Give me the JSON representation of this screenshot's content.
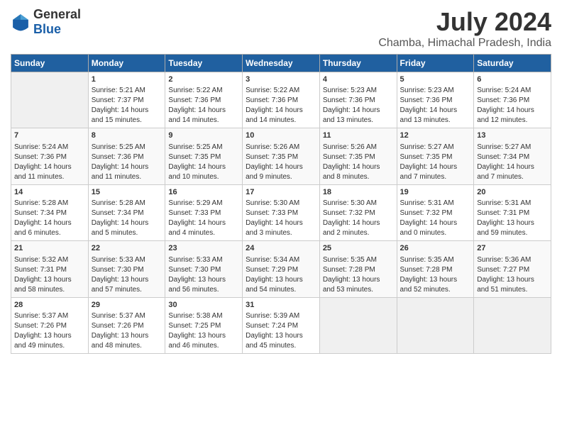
{
  "header": {
    "logo_general": "General",
    "logo_blue": "Blue",
    "title": "July 2024",
    "subtitle": "Chamba, Himachal Pradesh, India"
  },
  "weekdays": [
    "Sunday",
    "Monday",
    "Tuesday",
    "Wednesday",
    "Thursday",
    "Friday",
    "Saturday"
  ],
  "weeks": [
    [
      {
        "day": "",
        "sunrise": "",
        "sunset": "",
        "daylight": ""
      },
      {
        "day": "1",
        "sunrise": "Sunrise: 5:21 AM",
        "sunset": "Sunset: 7:37 PM",
        "daylight": "Daylight: 14 hours and 15 minutes."
      },
      {
        "day": "2",
        "sunrise": "Sunrise: 5:22 AM",
        "sunset": "Sunset: 7:36 PM",
        "daylight": "Daylight: 14 hours and 14 minutes."
      },
      {
        "day": "3",
        "sunrise": "Sunrise: 5:22 AM",
        "sunset": "Sunset: 7:36 PM",
        "daylight": "Daylight: 14 hours and 14 minutes."
      },
      {
        "day": "4",
        "sunrise": "Sunrise: 5:23 AM",
        "sunset": "Sunset: 7:36 PM",
        "daylight": "Daylight: 14 hours and 13 minutes."
      },
      {
        "day": "5",
        "sunrise": "Sunrise: 5:23 AM",
        "sunset": "Sunset: 7:36 PM",
        "daylight": "Daylight: 14 hours and 13 minutes."
      },
      {
        "day": "6",
        "sunrise": "Sunrise: 5:24 AM",
        "sunset": "Sunset: 7:36 PM",
        "daylight": "Daylight: 14 hours and 12 minutes."
      }
    ],
    [
      {
        "day": "7",
        "sunrise": "Sunrise: 5:24 AM",
        "sunset": "Sunset: 7:36 PM",
        "daylight": "Daylight: 14 hours and 11 minutes."
      },
      {
        "day": "8",
        "sunrise": "Sunrise: 5:25 AM",
        "sunset": "Sunset: 7:36 PM",
        "daylight": "Daylight: 14 hours and 11 minutes."
      },
      {
        "day": "9",
        "sunrise": "Sunrise: 5:25 AM",
        "sunset": "Sunset: 7:35 PM",
        "daylight": "Daylight: 14 hours and 10 minutes."
      },
      {
        "day": "10",
        "sunrise": "Sunrise: 5:26 AM",
        "sunset": "Sunset: 7:35 PM",
        "daylight": "Daylight: 14 hours and 9 minutes."
      },
      {
        "day": "11",
        "sunrise": "Sunrise: 5:26 AM",
        "sunset": "Sunset: 7:35 PM",
        "daylight": "Daylight: 14 hours and 8 minutes."
      },
      {
        "day": "12",
        "sunrise": "Sunrise: 5:27 AM",
        "sunset": "Sunset: 7:35 PM",
        "daylight": "Daylight: 14 hours and 7 minutes."
      },
      {
        "day": "13",
        "sunrise": "Sunrise: 5:27 AM",
        "sunset": "Sunset: 7:34 PM",
        "daylight": "Daylight: 14 hours and 7 minutes."
      }
    ],
    [
      {
        "day": "14",
        "sunrise": "Sunrise: 5:28 AM",
        "sunset": "Sunset: 7:34 PM",
        "daylight": "Daylight: 14 hours and 6 minutes."
      },
      {
        "day": "15",
        "sunrise": "Sunrise: 5:28 AM",
        "sunset": "Sunset: 7:34 PM",
        "daylight": "Daylight: 14 hours and 5 minutes."
      },
      {
        "day": "16",
        "sunrise": "Sunrise: 5:29 AM",
        "sunset": "Sunset: 7:33 PM",
        "daylight": "Daylight: 14 hours and 4 minutes."
      },
      {
        "day": "17",
        "sunrise": "Sunrise: 5:30 AM",
        "sunset": "Sunset: 7:33 PM",
        "daylight": "Daylight: 14 hours and 3 minutes."
      },
      {
        "day": "18",
        "sunrise": "Sunrise: 5:30 AM",
        "sunset": "Sunset: 7:32 PM",
        "daylight": "Daylight: 14 hours and 2 minutes."
      },
      {
        "day": "19",
        "sunrise": "Sunrise: 5:31 AM",
        "sunset": "Sunset: 7:32 PM",
        "daylight": "Daylight: 14 hours and 0 minutes."
      },
      {
        "day": "20",
        "sunrise": "Sunrise: 5:31 AM",
        "sunset": "Sunset: 7:31 PM",
        "daylight": "Daylight: 13 hours and 59 minutes."
      }
    ],
    [
      {
        "day": "21",
        "sunrise": "Sunrise: 5:32 AM",
        "sunset": "Sunset: 7:31 PM",
        "daylight": "Daylight: 13 hours and 58 minutes."
      },
      {
        "day": "22",
        "sunrise": "Sunrise: 5:33 AM",
        "sunset": "Sunset: 7:30 PM",
        "daylight": "Daylight: 13 hours and 57 minutes."
      },
      {
        "day": "23",
        "sunrise": "Sunrise: 5:33 AM",
        "sunset": "Sunset: 7:30 PM",
        "daylight": "Daylight: 13 hours and 56 minutes."
      },
      {
        "day": "24",
        "sunrise": "Sunrise: 5:34 AM",
        "sunset": "Sunset: 7:29 PM",
        "daylight": "Daylight: 13 hours and 54 minutes."
      },
      {
        "day": "25",
        "sunrise": "Sunrise: 5:35 AM",
        "sunset": "Sunset: 7:28 PM",
        "daylight": "Daylight: 13 hours and 53 minutes."
      },
      {
        "day": "26",
        "sunrise": "Sunrise: 5:35 AM",
        "sunset": "Sunset: 7:28 PM",
        "daylight": "Daylight: 13 hours and 52 minutes."
      },
      {
        "day": "27",
        "sunrise": "Sunrise: 5:36 AM",
        "sunset": "Sunset: 7:27 PM",
        "daylight": "Daylight: 13 hours and 51 minutes."
      }
    ],
    [
      {
        "day": "28",
        "sunrise": "Sunrise: 5:37 AM",
        "sunset": "Sunset: 7:26 PM",
        "daylight": "Daylight: 13 hours and 49 minutes."
      },
      {
        "day": "29",
        "sunrise": "Sunrise: 5:37 AM",
        "sunset": "Sunset: 7:26 PM",
        "daylight": "Daylight: 13 hours and 48 minutes."
      },
      {
        "day": "30",
        "sunrise": "Sunrise: 5:38 AM",
        "sunset": "Sunset: 7:25 PM",
        "daylight": "Daylight: 13 hours and 46 minutes."
      },
      {
        "day": "31",
        "sunrise": "Sunrise: 5:39 AM",
        "sunset": "Sunset: 7:24 PM",
        "daylight": "Daylight: 13 hours and 45 minutes."
      },
      {
        "day": "",
        "sunrise": "",
        "sunset": "",
        "daylight": ""
      },
      {
        "day": "",
        "sunrise": "",
        "sunset": "",
        "daylight": ""
      },
      {
        "day": "",
        "sunrise": "",
        "sunset": "",
        "daylight": ""
      }
    ]
  ]
}
